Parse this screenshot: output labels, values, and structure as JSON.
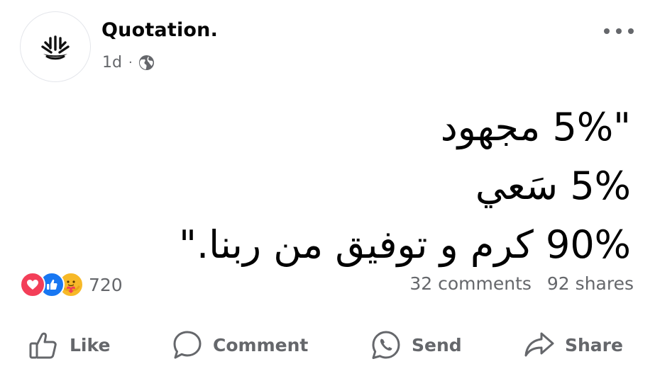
{
  "header": {
    "page_name": "Quotation.",
    "time": "1d",
    "separator": "·",
    "privacy_icon": "globe-icon",
    "avatar_icon": "plant-logo",
    "more_icon": "more-horizontal-icon"
  },
  "post": {
    "quote_lines": [
      "\"5% مجهود",
      "5% سَعي",
      "90% كرم و توفيق من ربنا.\""
    ]
  },
  "stats": {
    "reaction_icons": [
      "love-icon",
      "like-icon",
      "care-icon"
    ],
    "reaction_count": "720",
    "comments": "32 comments",
    "shares": "92 shares"
  },
  "actions": {
    "like": "Like",
    "comment": "Comment",
    "send": "Send",
    "share": "Share"
  },
  "colors": {
    "text_primary": "#050505",
    "text_secondary": "#65676b",
    "like_blue": "#1877f2",
    "love_red": "#f33e58",
    "care_yellow": "#f7b928"
  }
}
